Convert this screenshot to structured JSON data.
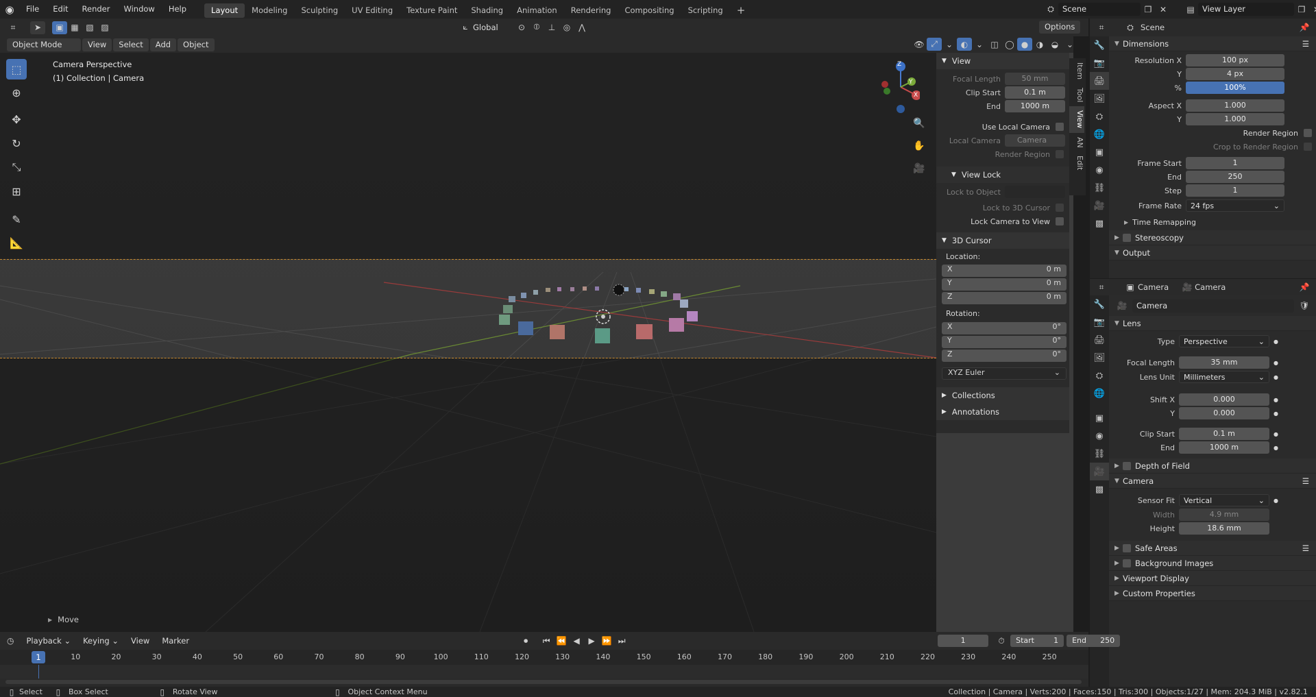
{
  "topbar": {
    "menus": [
      "File",
      "Edit",
      "Render",
      "Window",
      "Help"
    ],
    "workspaces": [
      "Layout",
      "Modeling",
      "Sculpting",
      "UV Editing",
      "Texture Paint",
      "Shading",
      "Animation",
      "Rendering",
      "Compositing",
      "Scripting"
    ],
    "active_workspace": "Layout",
    "add_workspace": "+",
    "scene_label": "Scene",
    "view_layer_label": "View Layer"
  },
  "viewport_header": {
    "mode": "Object Mode",
    "menus": [
      "View",
      "Select",
      "Add",
      "Object"
    ],
    "orientation": "Global",
    "options": "Options"
  },
  "viewport": {
    "overlay_line1": "Camera Perspective",
    "overlay_line2": "(1) Collection | Camera",
    "last_op": "Move",
    "gizmo_z": "Z",
    "gizmo_y": "Y",
    "gizmo_x": "X"
  },
  "npanel": {
    "view_header": "View",
    "focal_length_label": "Focal Length",
    "focal_length": "50 mm",
    "clip_start_label": "Clip Start",
    "clip_start": "0.1 m",
    "clip_end_label": "End",
    "clip_end": "1000 m",
    "use_local_camera": "Use Local Camera",
    "local_camera_label": "Local Camera",
    "local_camera": "Camera",
    "render_region": "Render Region",
    "view_lock_header": "View Lock",
    "lock_to_object": "Lock to Object",
    "lock_to_cursor": "Lock to 3D Cursor",
    "lock_camera": "Lock Camera to View",
    "cursor_header": "3D Cursor",
    "location_label": "Location:",
    "loc": [
      {
        "axis": "X",
        "val": "0 m"
      },
      {
        "axis": "Y",
        "val": "0 m"
      },
      {
        "axis": "Z",
        "val": "0 m"
      }
    ],
    "rotation_label": "Rotation:",
    "rot": [
      {
        "axis": "X",
        "val": "0°"
      },
      {
        "axis": "Y",
        "val": "0°"
      },
      {
        "axis": "Z",
        "val": "0°"
      }
    ],
    "rotation_mode": "XYZ Euler",
    "collections": "Collections",
    "annotations": "Annotations"
  },
  "sidetabs": [
    "Item",
    "Tool",
    "View",
    "AN",
    "Edit"
  ],
  "props_scene": {
    "context": "Scene",
    "dimensions": "Dimensions",
    "res_x_label": "Resolution X",
    "res_x": "100 px",
    "res_y_label": "Y",
    "res_y": "4 px",
    "res_pct_label": "%",
    "res_pct": "100%",
    "aspect_x_label": "Aspect X",
    "aspect_x": "1.000",
    "aspect_y_label": "Y",
    "aspect_y": "1.000",
    "render_region": "Render Region",
    "crop_region": "Crop to Render Region",
    "frame_start_label": "Frame Start",
    "frame_start": "1",
    "frame_end_label": "End",
    "frame_end": "250",
    "frame_step_label": "Step",
    "frame_step": "1",
    "frame_rate_label": "Frame Rate",
    "frame_rate": "24 fps",
    "time_remapping": "Time Remapping",
    "stereoscopy": "Stereoscopy",
    "output": "Output"
  },
  "props_camera": {
    "breadcrumb_obj": "Camera",
    "breadcrumb_data": "Camera",
    "datablock": "Camera",
    "lens": "Lens",
    "type_label": "Type",
    "type": "Perspective",
    "focal_label": "Focal Length",
    "focal": "35 mm",
    "lens_unit_label": "Lens Unit",
    "lens_unit": "Millimeters",
    "shift_x_label": "Shift X",
    "shift_x": "0.000",
    "shift_y_label": "Y",
    "shift_y": "0.000",
    "clip_start_label": "Clip Start",
    "clip_start": "0.1 m",
    "clip_end_label": "End",
    "clip_end": "1000 m",
    "dof": "Depth of Field",
    "camera_sec": "Camera",
    "sensor_fit_label": "Sensor Fit",
    "sensor_fit": "Vertical",
    "width_label": "Width",
    "width": "4.9 mm",
    "height_label": "Height",
    "height": "18.6 mm",
    "safe_areas": "Safe Areas",
    "background_images": "Background Images",
    "viewport_display": "Viewport Display",
    "custom_properties": "Custom Properties"
  },
  "timeline": {
    "menus": [
      "Playback",
      "Keying",
      "View",
      "Marker"
    ],
    "current_frame": "1",
    "start_label": "Start",
    "start": "1",
    "end_label": "End",
    "end": "250",
    "ticks": [
      "1",
      "10",
      "20",
      "30",
      "40",
      "50",
      "60",
      "70",
      "80",
      "90",
      "100",
      "110",
      "120",
      "130",
      "140",
      "150",
      "160",
      "170",
      "180",
      "190",
      "200",
      "210",
      "220",
      "230",
      "240",
      "250"
    ]
  },
  "statusbar": {
    "select": "Select",
    "box_select": "Box Select",
    "rotate": "Rotate View",
    "context_menu": "Object Context Menu",
    "stats": "Collection | Camera | Verts:200 | Faces:150 | Tris:300 | Objects:1/27 | Mem: 204.3 MiB | v2.82.1"
  },
  "colors": {
    "accent": "#4772b3",
    "camera_frame": "#c88a2c",
    "bg": "#1d1d1d"
  }
}
